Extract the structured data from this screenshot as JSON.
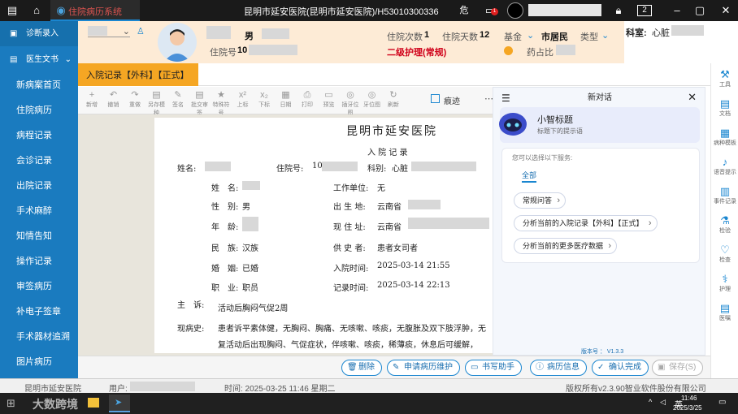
{
  "titlebar": {
    "app_tab": "住院病历系统",
    "title": "昆明市延安医院(昆明市延安医院)/H53010300336",
    "danger_label": "危",
    "screen_count": "2",
    "notification_count": "1"
  },
  "sidebar": {
    "top_item": "诊断录入",
    "section": "医生文书",
    "items": [
      "新病案首页",
      "住院病历",
      "病程记录",
      "会诊记录",
      "出院记录",
      "手术麻醉",
      "知情告知",
      "操作记录",
      "审签病历",
      "补电子签章",
      "手术器材追溯",
      "图片病历"
    ]
  },
  "patient": {
    "gender": "男",
    "admission_no_label": "住院号",
    "admission_no": "10",
    "visits_label": "住院次数",
    "visits": "1",
    "days_label": "住院天数",
    "days": "12",
    "fund_label": "基金",
    "insurance": "市居民",
    "type_label": "类型",
    "nursing_level": "二级护理(常规)",
    "drug_ratio_label": "药占比",
    "ward_label": "科室:",
    "ward": "心脏"
  },
  "doc_tab": "入院记录【外科】【正式】",
  "toolbar": {
    "items": [
      "新增",
      "撤销",
      "重做",
      "另存模种",
      "签名",
      "批交审签",
      "特殊符号",
      "上标",
      "下标",
      "日期",
      "打印",
      "预览",
      "插牙位图",
      "牙位图",
      "刷新"
    ],
    "trace_label": "痕迹"
  },
  "document": {
    "hospital": "昆明市延安医院",
    "doc_title": "入 院 记 录",
    "name_label": "姓名:",
    "admission_no_label": "住院号:",
    "admission_no_value": "10",
    "dept_label": "科别:",
    "dept_value": "心脏",
    "fields": {
      "name_label": "姓　名:",
      "gender_label": "性　别:",
      "gender": "男",
      "age_label": "年　龄:",
      "ethnicity_label": "民　族:",
      "ethnicity": "汉族",
      "marital_label": "婚　姻:",
      "marital": "已婚",
      "occupation_label": "职　业:",
      "occupation": "职员",
      "workplace_label": "工作单位:",
      "workplace": "无",
      "birthplace_label": "出 生 地:",
      "birthplace": "云南省",
      "address_label": "现 住 址:",
      "address": "云南省",
      "informant_label": "供 史 者:",
      "informant": "患者女司者",
      "admit_time_label": "入院时间:",
      "admit_time": "2025-03-14 21:55",
      "record_time_label": "记录时间:",
      "record_time": "2025-03-14 22:13"
    },
    "complaint_label": "主　诉:",
    "complaint": "活动后胸闷气促2周",
    "history_label": "现病史:",
    "history_line1": "患者诉平素体健，无胸闷、胸痛、无咳嗽、咳痰，无腹胀及双下肢浮肿，无",
    "history_line2": "复活动后出现胸闷、气促症状，伴咳嗽、咳痰，稀薄痰，休息后可缓解，"
  },
  "chat": {
    "title": "新对话",
    "bot_name": "小智标题",
    "bot_subtitle": "标题下的提示语",
    "prompt": "您可以选择以下服务:",
    "tab_all": "全部",
    "options": [
      "常规问答",
      "分析当前的入院记录【外科】【正式】",
      "分析当前的更多医疗数据"
    ],
    "version": "版本号 ： V1.3.3"
  },
  "right_strip": [
    "工具",
    "文档",
    "病种模板",
    "语音提示",
    "事件记录",
    "检验",
    "检查",
    "护理",
    "医嘱"
  ],
  "actions": {
    "delete": "删除",
    "apply_maintain": "申请病历维护",
    "writing_assistant": "书写助手",
    "record_info": "病历信息",
    "confirm_done": "确认完成",
    "save": "保存(S)"
  },
  "statusbar": {
    "hospital": "昆明市延安医院",
    "user_label": "用户:",
    "time": "时间: 2025-03-25 11:46 星期二",
    "copyright": "版权所有v2.3.90智业软件股份有限公司"
  },
  "taskbar": {
    "ime": "英",
    "clock_time": "11:46",
    "clock_date": "2025/3/25",
    "watermark": "大数跨境"
  },
  "colors": {
    "sidebar": "#1a7bbf",
    "accent": "#1a86d0",
    "tab_orange": "#f5a623",
    "header_bg": "#fdebd6",
    "alert_red": "#d0021b"
  }
}
